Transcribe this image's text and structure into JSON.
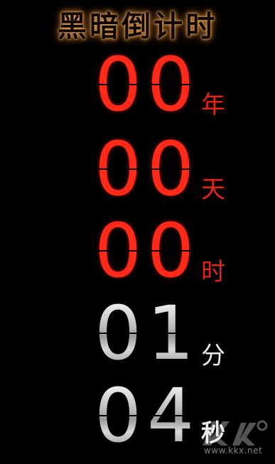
{
  "app": {
    "title": "黑暗倒计时"
  },
  "countdown": {
    "years": {
      "digits": [
        "0",
        "0"
      ],
      "unit": "年",
      "color": "#ff2a1a"
    },
    "days": {
      "digits": [
        "0",
        "0"
      ],
      "unit": "天",
      "color": "#ff2a1a"
    },
    "hours": {
      "digits": [
        "0",
        "0"
      ],
      "unit": "时",
      "color": "#ff2a1a"
    },
    "minutes": {
      "digits": [
        "0",
        "1"
      ],
      "unit": "分",
      "color": "#c8c8c8"
    },
    "seconds": {
      "digits": [
        "0",
        "4"
      ],
      "unit": "秒",
      "color": "#c8c8c8"
    }
  },
  "watermark": {
    "text": "www.kkx.net",
    "icon": "kkx-logo-icon"
  }
}
